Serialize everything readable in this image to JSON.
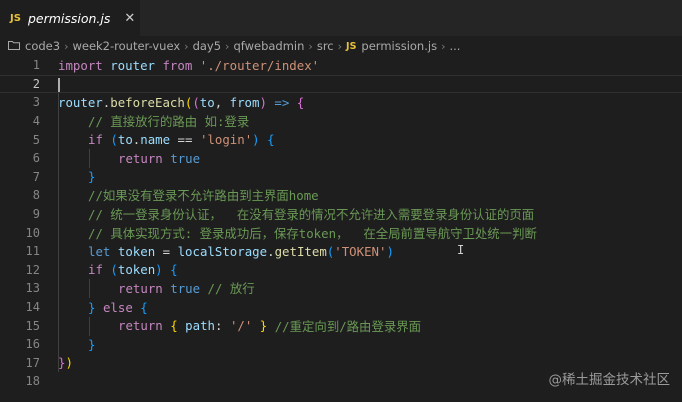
{
  "tab": {
    "icon_label": "JS",
    "file_name": "permission.js",
    "close_glyph": "✕"
  },
  "breadcrumb": {
    "items": [
      "code3",
      "week2-router-vuex",
      "day5",
      "qfwebadmin",
      "src"
    ],
    "file_icon_label": "JS",
    "file_name": "permission.js",
    "ellipsis": "..."
  },
  "editor": {
    "line_numbers": [
      "1",
      "2",
      "3",
      "4",
      "5",
      "6",
      "7",
      "8",
      "9",
      "10",
      "11",
      "12",
      "13",
      "14",
      "15",
      "16",
      "17",
      "18"
    ],
    "lines": {
      "l1": {
        "kw_import": "import",
        "ident": " router ",
        "kw_from": "from",
        "sp": " ",
        "str": "'./router/index'"
      },
      "l3": {
        "obj": "router",
        "dot": ".",
        "fn": "beforeEach",
        "p1": "(",
        "p2": "(",
        "a1": "to",
        "comma": ", ",
        "a2": "from",
        "p3": ")",
        "arrow": " => ",
        "b": "{"
      },
      "l4": {
        "cm": "// 直接放行的路由 如:登录"
      },
      "l5": {
        "kw": "if",
        "sp": " ",
        "p": "(",
        "obj": "to",
        "dot": ".",
        "prop": "name",
        "op": " == ",
        "str": "'login'",
        "pc": ")",
        "sp2": " ",
        "b": "{"
      },
      "l6": {
        "kw": "return",
        "sp": " ",
        "val": "true"
      },
      "l7": {
        "b": "}"
      },
      "l8": {
        "cm": "//如果没有登录不允许路由到主界面home"
      },
      "l9": {
        "cm": "// 统一登录身份认证，  在没有登录的情况不允许进入需要登录身份认证的页面"
      },
      "l10": {
        "cm": "// 具体实现方式: 登录成功后，保存token，  在全局前置导航守卫处统一判断"
      },
      "l11": {
        "kw": "let",
        "sp": " ",
        "var": "token",
        "eq": " = ",
        "obj": "localStorage",
        "dot": ".",
        "fn": "getItem",
        "p": "(",
        "str": "'TOKEN'",
        "pc": ")"
      },
      "l12": {
        "kw": "if",
        "sp": " ",
        "p": "(",
        "var": "token",
        "pc": ")",
        "sp2": " ",
        "b": "{"
      },
      "l13": {
        "kw": "return",
        "sp": " ",
        "val": "true",
        "cm": " // 放行"
      },
      "l14": {
        "bc": "}",
        "sp": " ",
        "kw": "else",
        "sp2": " ",
        "b": "{"
      },
      "l15": {
        "kw": "return",
        "sp": " ",
        "b1": "{",
        "sp2": " ",
        "key": "path",
        "colon": ": ",
        "str": "'/'",
        "sp3": " ",
        "b2": "}",
        "cm": " //重定向到/路由登录界面"
      },
      "l16": {
        "b": "}"
      },
      "l17": {
        "b": "}",
        "p": ")"
      }
    }
  },
  "cursor_glyph": "I",
  "watermark": "@稀土掘金技术社区"
}
